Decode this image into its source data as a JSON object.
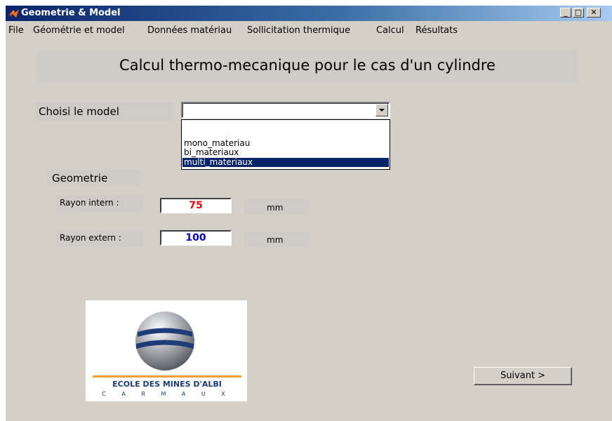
{
  "window": {
    "title": "Geometrie & Model",
    "controls": {
      "minimize": "_",
      "maximize": "□",
      "close": "✕"
    }
  },
  "menu": [
    "File",
    "Géométrie et model",
    "Données matériau",
    "Sollicitation thermique",
    "Calcul",
    "Résultats"
  ],
  "heading": "Calcul thermo-mecanique pour le cas d'un cylindre",
  "model": {
    "label": "Choisi le model",
    "selected": "",
    "options": [
      "mono_materiau",
      "bi_materiaux",
      "multi_materiaux"
    ],
    "highlighted_index": 2
  },
  "geometry": {
    "section_label": "Geometrie",
    "rayon_intern": {
      "label": "Rayon intern :",
      "value": "75",
      "unit": "mm",
      "color": "#ff0000"
    },
    "rayon_extern": {
      "label": "Rayon extern :",
      "value": "100",
      "unit": "mm",
      "color": "#0000cc"
    }
  },
  "logo": {
    "line1": "ECOLE DES MINES D'ALBI",
    "line2": "C A R M A U X",
    "accent": "#f0a030"
  },
  "next_button": "Suivant >"
}
